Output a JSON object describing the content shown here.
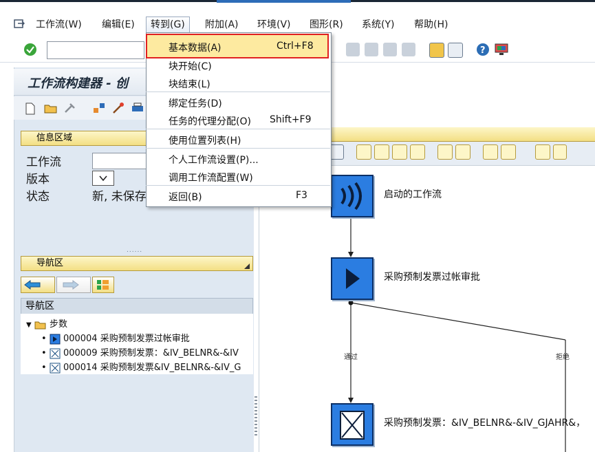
{
  "menubar": {
    "items": [
      "工作流(W)",
      "编辑(E)",
      "转到(G)",
      "附加(A)",
      "环境(V)",
      "图形(R)",
      "系统(Y)",
      "帮助(H)"
    ]
  },
  "dropdown": {
    "items": [
      {
        "label": "基本数据(A)",
        "shortcut": "Ctrl+F8"
      },
      {
        "label": "块开始(C)",
        "shortcut": ""
      },
      {
        "label": "块结束(L)",
        "shortcut": ""
      },
      {
        "label": "绑定任务(D)",
        "shortcut": ""
      },
      {
        "label": "任务的代理分配(O)",
        "shortcut": "Shift+F9"
      },
      {
        "label": "使用位置列表(H)",
        "shortcut": ""
      },
      {
        "label": "个人工作流设置(P)...",
        "shortcut": ""
      },
      {
        "label": "调用工作流配置(W)",
        "shortcut": ""
      },
      {
        "label": "返回(B)",
        "shortcut": "F3"
      }
    ]
  },
  "left": {
    "title": "工作流构建器 - 创",
    "info_header": "信息区域",
    "fields": {
      "workflow_label": "工作流",
      "version_label": "版本",
      "status_label": "状态",
      "status_value": "新, 未保存"
    },
    "nav_header": "导航区",
    "nav_subheader": "导航区",
    "tree": {
      "root": "步数",
      "items": [
        "000004 采购预制发票过帐审批",
        "000009 采购预制发票：&IV_BELNR&-&IV",
        "000014 采购预制发票&IV_BELNR&-&IV_G"
      ]
    }
  },
  "canvas": {
    "nodes": {
      "start": "启动的工作流",
      "approval": "采购预制发票过帐审批",
      "invoice": "采购预制发票：&IV_BELNR&-&IV_GJAHR&，"
    },
    "branch_labels": {
      "left": "通过",
      "right": "拒绝"
    }
  },
  "colors": {
    "accent": "#2b7de1",
    "highlight_border": "#e02020",
    "section_header": "#f3df84"
  }
}
